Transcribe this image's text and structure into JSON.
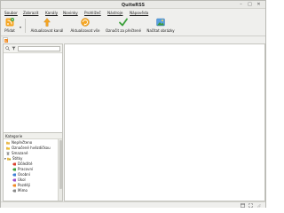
{
  "app": {
    "title": "QuiteRSS"
  },
  "window_buttons": {
    "minimize": "–",
    "maximize": "□",
    "close": "✕"
  },
  "menu": {
    "items": [
      {
        "label": "Soubor"
      },
      {
        "label": "Zobrazit"
      },
      {
        "label": "Kanály"
      },
      {
        "label": "Novinky"
      },
      {
        "label": "Prohlížeč"
      },
      {
        "label": "Nástroje"
      },
      {
        "label": "Nápověda"
      }
    ]
  },
  "toolbar": {
    "add_label": "Přidat",
    "update_feed_label": "Aktualizovat kanál",
    "update_all_label": "Aktualizovat vše",
    "mark_read_label": "Označit za přečtené",
    "load_images_label": "Načítat obrázky"
  },
  "categories": {
    "header": "Kategorie",
    "items": [
      {
        "label": "Nepřečteno",
        "icon": "folder-icon"
      },
      {
        "label": "Označené hvězdičkou",
        "icon": "star-folder-icon"
      },
      {
        "label": "Smazané",
        "icon": "trash-icon"
      },
      {
        "label": "Štítky",
        "icon": "tag-folder-icon",
        "expanded": true
      },
      {
        "label": "Důležité",
        "icon": "tag-red-icon"
      },
      {
        "label": "Pracovní",
        "icon": "tag-green-icon"
      },
      {
        "label": "Osobní",
        "icon": "tag-blue-icon"
      },
      {
        "label": "Úkol",
        "icon": "tag-purple-icon"
      },
      {
        "label": "Později",
        "icon": "tag-orange-icon"
      },
      {
        "label": "Mimo",
        "icon": "tag-gray-icon"
      }
    ]
  },
  "colors": {
    "accent": "#3c8fd6",
    "tab_orange": "#f08a24"
  }
}
